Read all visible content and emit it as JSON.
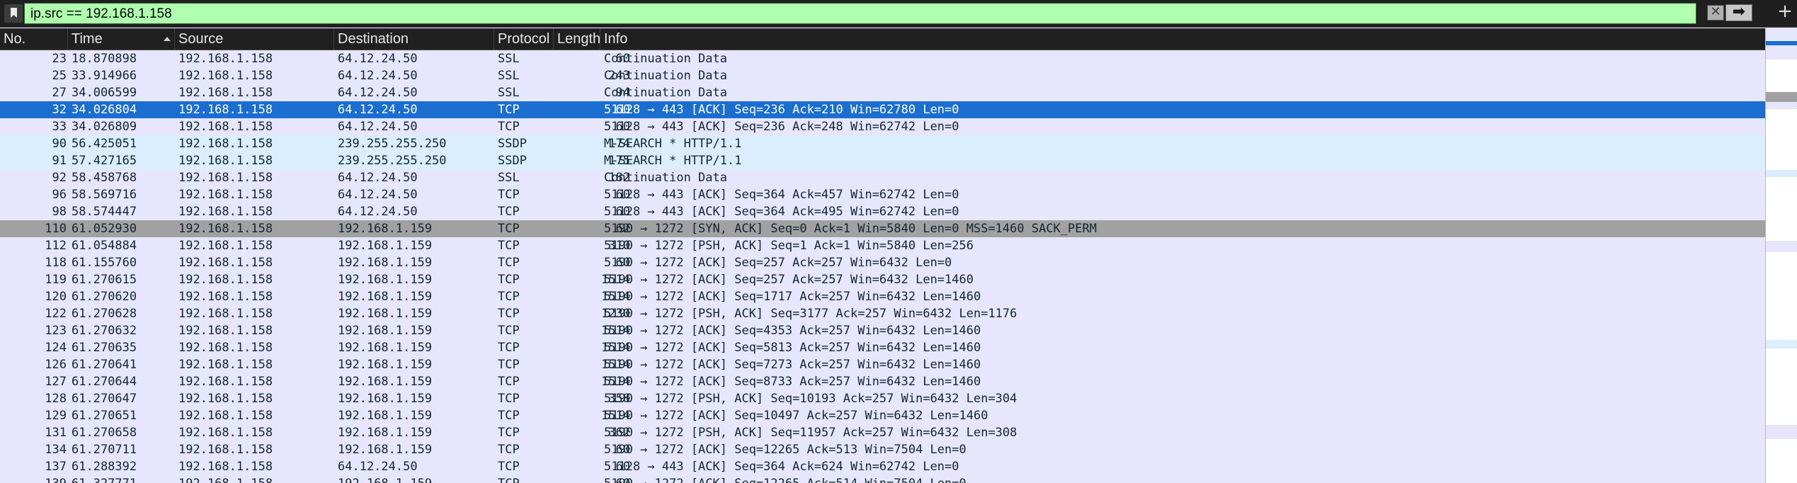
{
  "filter": {
    "expression": "ip.src == 192.168.1.158",
    "apply_glyph": "➡",
    "clear_glyph": "✕",
    "add_glyph": "+"
  },
  "columns": [
    "No.",
    "Time",
    "Source",
    "Destination",
    "Protocol",
    "Length",
    "Info"
  ],
  "packets": [
    {
      "no": "23",
      "time": "18.870898",
      "src": "192.168.1.158",
      "dst": "64.12.24.50",
      "proto": "SSL",
      "len": "60",
      "info": "Continuation Data",
      "bg": "#e7e6ff"
    },
    {
      "no": "25",
      "time": "33.914966",
      "src": "192.168.1.158",
      "dst": "64.12.24.50",
      "proto": "SSL",
      "len": "243",
      "info": "Continuation Data",
      "bg": "#e7e6ff"
    },
    {
      "no": "27",
      "time": "34.006599",
      "src": "192.168.1.158",
      "dst": "64.12.24.50",
      "proto": "SSL",
      "len": "94",
      "info": "Continuation Data",
      "bg": "#e7e6ff"
    },
    {
      "no": "32",
      "time": "34.026804",
      "src": "192.168.1.158",
      "dst": "64.12.24.50",
      "proto": "TCP",
      "len": "60",
      "info": "51128 → 443 [ACK] Seq=236 Ack=210 Win=62780 Len=0",
      "bg": "#1a6ed0",
      "selected": true
    },
    {
      "no": "33",
      "time": "34.026809",
      "src": "192.168.1.158",
      "dst": "64.12.24.50",
      "proto": "TCP",
      "len": "60",
      "info": "51128 → 443 [ACK] Seq=236 Ack=248 Win=62742 Len=0",
      "bg": "#e7e6ff"
    },
    {
      "no": "90",
      "time": "56.425051",
      "src": "192.168.1.158",
      "dst": "239.255.255.250",
      "proto": "SSDP",
      "len": "174",
      "info": "M-SEARCH * HTTP/1.1",
      "bg": "#daeeff"
    },
    {
      "no": "91",
      "time": "57.427165",
      "src": "192.168.1.158",
      "dst": "239.255.255.250",
      "proto": "SSDP",
      "len": "175",
      "info": "M-SEARCH * HTTP/1.1",
      "bg": "#daeeff"
    },
    {
      "no": "92",
      "time": "58.458768",
      "src": "192.168.1.158",
      "dst": "64.12.24.50",
      "proto": "SSL",
      "len": "182",
      "info": "Continuation Data",
      "bg": "#e7e6ff"
    },
    {
      "no": "96",
      "time": "58.569716",
      "src": "192.168.1.158",
      "dst": "64.12.24.50",
      "proto": "TCP",
      "len": "60",
      "info": "51128 → 443 [ACK] Seq=364 Ack=457 Win=62742 Len=0",
      "bg": "#e7e6ff"
    },
    {
      "no": "98",
      "time": "58.574447",
      "src": "192.168.1.158",
      "dst": "64.12.24.50",
      "proto": "TCP",
      "len": "60",
      "info": "51128 → 443 [ACK] Seq=364 Ack=495 Win=62742 Len=0",
      "bg": "#e7e6ff"
    },
    {
      "no": "110",
      "time": "61.052930",
      "src": "192.168.1.158",
      "dst": "192.168.1.159",
      "proto": "TCP",
      "len": "62",
      "info": "5190 → 1272 [SYN, ACK] Seq=0 Ack=1 Win=5840 Len=0 MSS=1460 SACK_PERM",
      "bg": "#a1a1a1",
      "marked": true
    },
    {
      "no": "112",
      "time": "61.054884",
      "src": "192.168.1.158",
      "dst": "192.168.1.159",
      "proto": "TCP",
      "len": "310",
      "info": "5190 → 1272 [PSH, ACK] Seq=1 Ack=1 Win=5840 Len=256",
      "bg": "#e7e6ff"
    },
    {
      "no": "118",
      "time": "61.155760",
      "src": "192.168.1.158",
      "dst": "192.168.1.159",
      "proto": "TCP",
      "len": "60",
      "info": "5190 → 1272 [ACK] Seq=257 Ack=257 Win=6432 Len=0",
      "bg": "#e7e6ff"
    },
    {
      "no": "119",
      "time": "61.270615",
      "src": "192.168.1.158",
      "dst": "192.168.1.159",
      "proto": "TCP",
      "len": "1514",
      "info": "5190 → 1272 [ACK] Seq=257 Ack=257 Win=6432 Len=1460",
      "bg": "#e7e6ff"
    },
    {
      "no": "120",
      "time": "61.270620",
      "src": "192.168.1.158",
      "dst": "192.168.1.159",
      "proto": "TCP",
      "len": "1514",
      "info": "5190 → 1272 [ACK] Seq=1717 Ack=257 Win=6432 Len=1460",
      "bg": "#e7e6ff"
    },
    {
      "no": "122",
      "time": "61.270628",
      "src": "192.168.1.158",
      "dst": "192.168.1.159",
      "proto": "TCP",
      "len": "1230",
      "info": "5190 → 1272 [PSH, ACK] Seq=3177 Ack=257 Win=6432 Len=1176",
      "bg": "#e7e6ff"
    },
    {
      "no": "123",
      "time": "61.270632",
      "src": "192.168.1.158",
      "dst": "192.168.1.159",
      "proto": "TCP",
      "len": "1514",
      "info": "5190 → 1272 [ACK] Seq=4353 Ack=257 Win=6432 Len=1460",
      "bg": "#e7e6ff"
    },
    {
      "no": "124",
      "time": "61.270635",
      "src": "192.168.1.158",
      "dst": "192.168.1.159",
      "proto": "TCP",
      "len": "1514",
      "info": "5190 → 1272 [ACK] Seq=5813 Ack=257 Win=6432 Len=1460",
      "bg": "#e7e6ff"
    },
    {
      "no": "126",
      "time": "61.270641",
      "src": "192.168.1.158",
      "dst": "192.168.1.159",
      "proto": "TCP",
      "len": "1514",
      "info": "5190 → 1272 [ACK] Seq=7273 Ack=257 Win=6432 Len=1460",
      "bg": "#e7e6ff"
    },
    {
      "no": "127",
      "time": "61.270644",
      "src": "192.168.1.158",
      "dst": "192.168.1.159",
      "proto": "TCP",
      "len": "1514",
      "info": "5190 → 1272 [ACK] Seq=8733 Ack=257 Win=6432 Len=1460",
      "bg": "#e7e6ff"
    },
    {
      "no": "128",
      "time": "61.270647",
      "src": "192.168.1.158",
      "dst": "192.168.1.159",
      "proto": "TCP",
      "len": "358",
      "info": "5190 → 1272 [PSH, ACK] Seq=10193 Ack=257 Win=6432 Len=304",
      "bg": "#e7e6ff"
    },
    {
      "no": "129",
      "time": "61.270651",
      "src": "192.168.1.158",
      "dst": "192.168.1.159",
      "proto": "TCP",
      "len": "1514",
      "info": "5190 → 1272 [ACK] Seq=10497 Ack=257 Win=6432 Len=1460",
      "bg": "#e7e6ff"
    },
    {
      "no": "131",
      "time": "61.270658",
      "src": "192.168.1.158",
      "dst": "192.168.1.159",
      "proto": "TCP",
      "len": "362",
      "info": "5190 → 1272 [PSH, ACK] Seq=11957 Ack=257 Win=6432 Len=308",
      "bg": "#e7e6ff"
    },
    {
      "no": "134",
      "time": "61.270711",
      "src": "192.168.1.158",
      "dst": "192.168.1.159",
      "proto": "TCP",
      "len": "60",
      "info": "5190 → 1272 [ACK] Seq=12265 Ack=513 Win=7504 Len=0",
      "bg": "#e7e6ff"
    },
    {
      "no": "137",
      "time": "61.288392",
      "src": "192.168.1.158",
      "dst": "64.12.24.50",
      "proto": "TCP",
      "len": "60",
      "info": "51128 → 443 [ACK] Seq=364 Ack=624 Win=62742 Len=0",
      "bg": "#e7e6ff"
    },
    {
      "no": "139",
      "time": "61.327771",
      "src": "192.168.1.158",
      "dst": "192.168.1.159",
      "proto": "TCP",
      "len": "60",
      "info": "5190 → 1272 [ACK] Seq=12265 Ack=514 Win=7504 Len=0",
      "bg": "#e7e6ff"
    }
  ],
  "minimap": {
    "colors": [
      "#e7e6ff",
      "#1a6ed0",
      "#daeeff",
      "#a1a1a1"
    ]
  }
}
